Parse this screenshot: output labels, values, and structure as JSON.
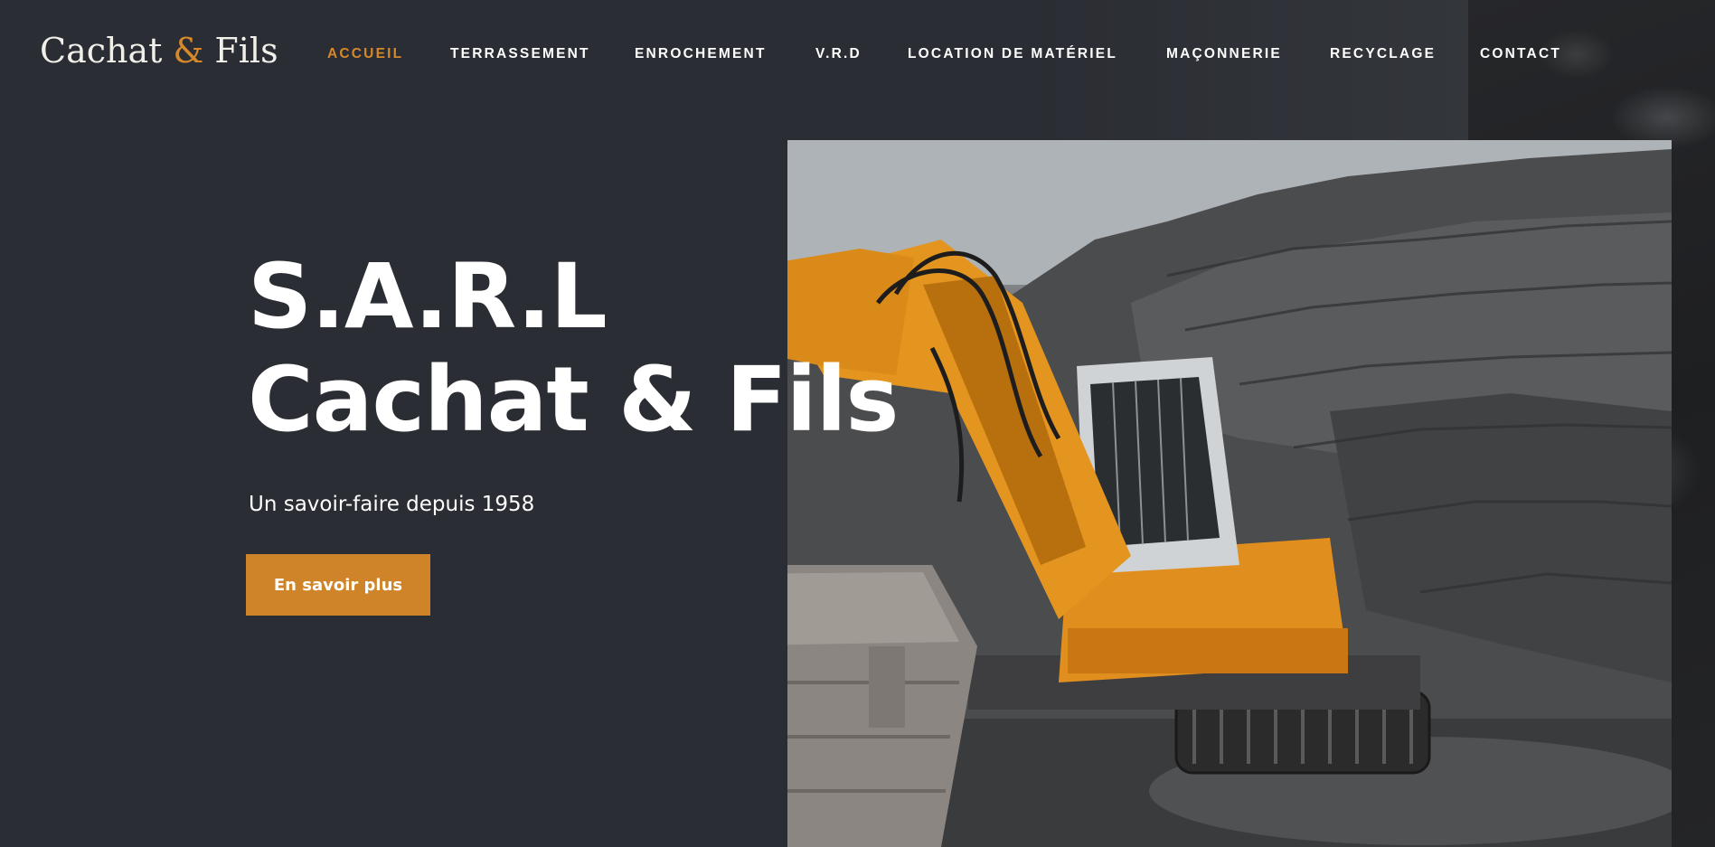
{
  "logo": {
    "part1": "Cachat ",
    "amp": "&",
    "part2": " Fils"
  },
  "nav": {
    "items": [
      {
        "label": "ACCUEIL",
        "active": true
      },
      {
        "label": "TERRASSEMENT",
        "active": false
      },
      {
        "label": "ENROCHEMENT",
        "active": false
      },
      {
        "label": "V.R.D",
        "active": false
      },
      {
        "label": "LOCATION DE MATÉRIEL",
        "active": false
      },
      {
        "label": "MAÇONNERIE",
        "active": false
      },
      {
        "label": "RECYCLAGE",
        "active": false
      },
      {
        "label": "CONTACT",
        "active": false
      }
    ]
  },
  "hero": {
    "title_line1": "S.A.R.L",
    "title_line2": "Cachat & Fils",
    "subtitle": "Un savoir-faire depuis 1958",
    "cta_label": "En savoir plus",
    "image_icon": "excavator-photo"
  },
  "colors": {
    "background": "#2a2d33",
    "accent": "#cf8429",
    "logo_amp": "#d6892b",
    "text": "#ffffff"
  }
}
